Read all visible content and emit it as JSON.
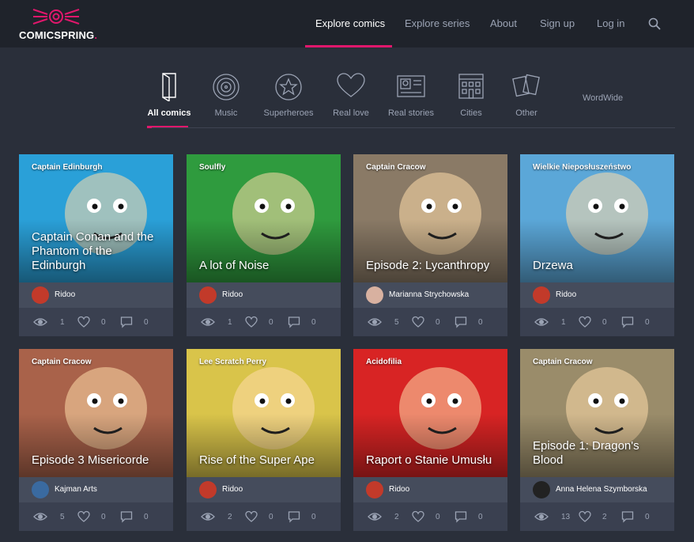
{
  "brand": {
    "name": "COMICSPRING",
    "dot": "."
  },
  "nav": [
    {
      "label": "Explore comics",
      "active": true
    },
    {
      "label": "Explore series"
    },
    {
      "label": "About"
    },
    {
      "label": "Sign up"
    },
    {
      "label": "Log in"
    }
  ],
  "categories": [
    {
      "label": "All comics",
      "icon": "book-icon",
      "active": true
    },
    {
      "label": "Music",
      "icon": "vinyl-icon"
    },
    {
      "label": "Superheroes",
      "icon": "star-badge-icon"
    },
    {
      "label": "Real love",
      "icon": "heart-icon"
    },
    {
      "label": "Real stories",
      "icon": "id-card-icon"
    },
    {
      "label": "Cities",
      "icon": "building-icon"
    },
    {
      "label": "Other",
      "icon": "cards-icon"
    }
  ],
  "region": "WordWide",
  "colors": {
    "accent": "#e0176c",
    "header": "#1f232b",
    "background": "#2a2f3a",
    "card": "#3a4050",
    "author_row": "#454c5c"
  },
  "comics": [
    {
      "series": "Captain Edinburgh",
      "title": "Captain Conan and the Phantom of the Edinburgh",
      "author": "Ridoo",
      "views": "1",
      "likes": "0",
      "comments": "0",
      "bg": "#2aa0d8"
    },
    {
      "series": "Soulfly",
      "title": "A lot of Noise",
      "author": "Ridoo",
      "views": "1",
      "likes": "0",
      "comments": "0",
      "bg": "#2f9b3e"
    },
    {
      "series": "Captain Cracow",
      "title": "Episode 2: Lycanthropy",
      "author": "Marianna Strychowska",
      "views": "5",
      "likes": "0",
      "comments": "0",
      "bg": "#8a7a66"
    },
    {
      "series": "Wielkie Nieposłuszeństwo",
      "title": "Drzewa",
      "author": "Ridoo",
      "views": "1",
      "likes": "0",
      "comments": "0",
      "bg": "#5ba7d8"
    },
    {
      "series": "Captain Cracow",
      "title": "Episode 3 Misericorde",
      "author": "Kajman Arts",
      "views": "5",
      "likes": "0",
      "comments": "0",
      "bg": "#a9624a"
    },
    {
      "series": "Lee Scratch Perry",
      "title": "Rise of the Super Ape",
      "author": "Ridoo",
      "views": "2",
      "likes": "0",
      "comments": "0",
      "bg": "#d9c44a"
    },
    {
      "series": "Acidofilia",
      "title": "Raport o Stanie Umusłu",
      "author": "Ridoo",
      "views": "2",
      "likes": "0",
      "comments": "0",
      "bg": "#d82424"
    },
    {
      "series": "Captain Cracow",
      "title": "Episode 1: Dragon's Blood",
      "author": "Anna Helena Szymborska",
      "views": "13",
      "likes": "2",
      "comments": "0",
      "bg": "#9a8c6a"
    }
  ]
}
